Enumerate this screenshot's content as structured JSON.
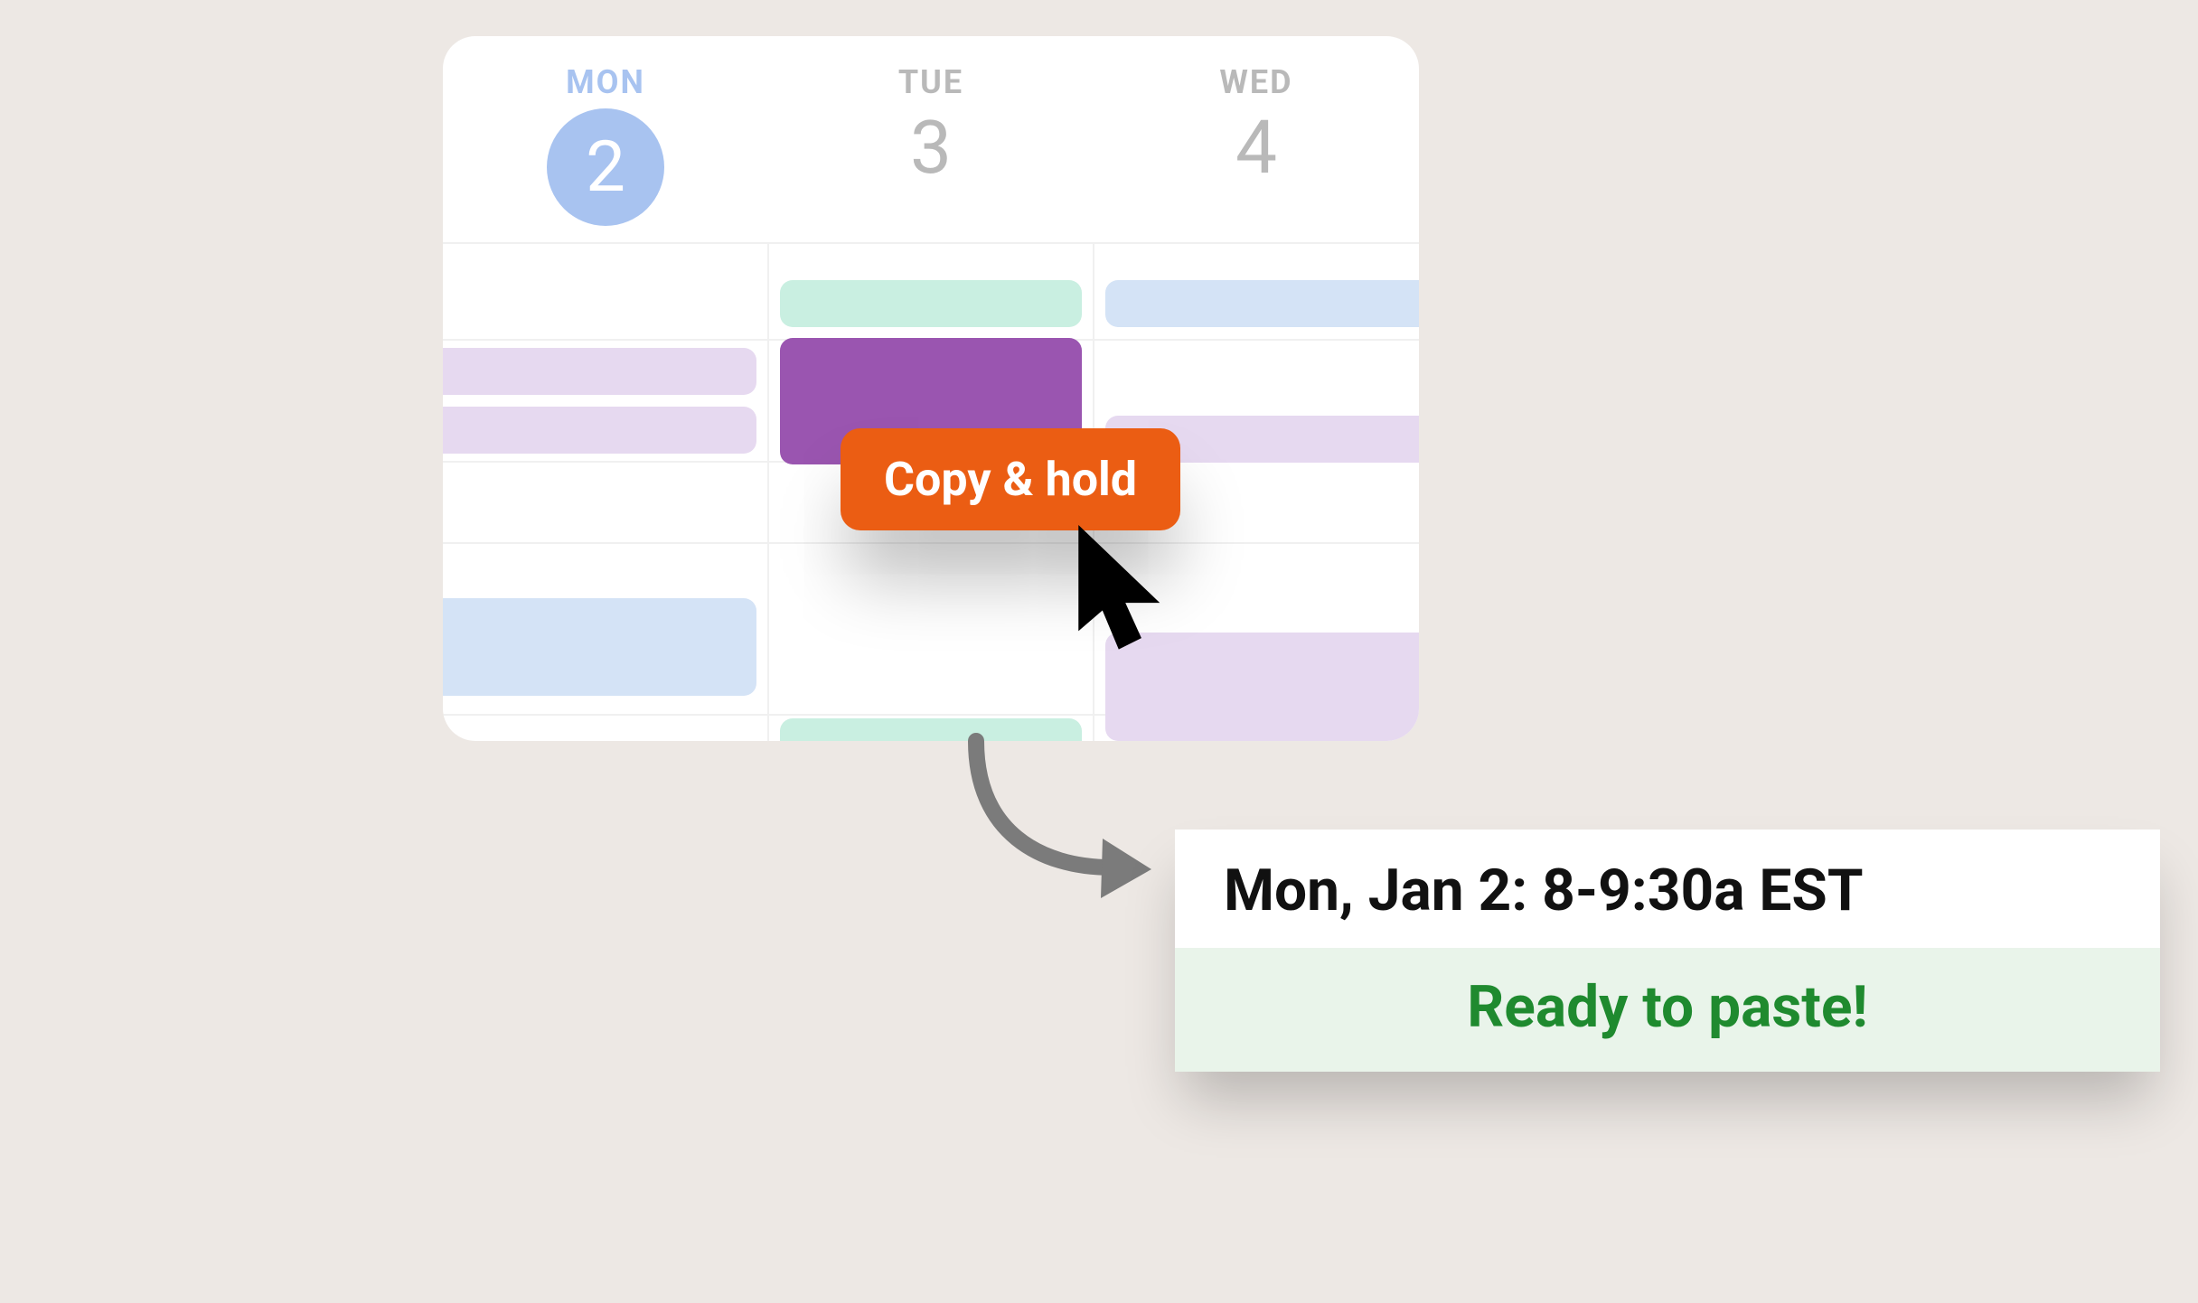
{
  "calendar": {
    "days": [
      {
        "label": "MON",
        "num": "2",
        "selected": true
      },
      {
        "label": "TUE",
        "num": "3",
        "selected": false
      },
      {
        "label": "WED",
        "num": "4",
        "selected": false
      }
    ]
  },
  "context_button": {
    "label": "Copy & hold"
  },
  "toast": {
    "summary": "Mon, Jan 2: 8-9:30a EST",
    "status": "Ready to paste!"
  },
  "colors": {
    "accent_orange": "#eb5d13",
    "selected_blue": "#a8c3f0",
    "purple_event": "#9a55b0",
    "status_green": "#1f8a2f"
  }
}
